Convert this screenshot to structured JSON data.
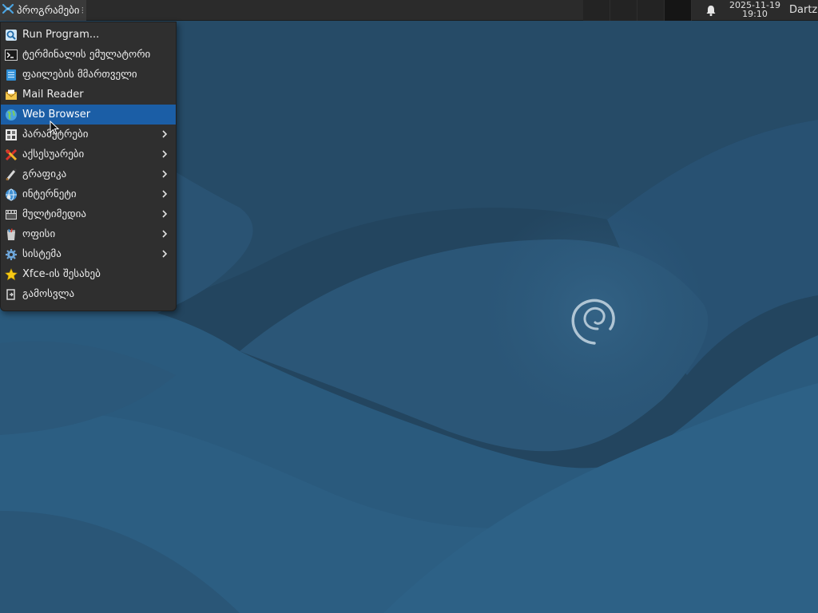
{
  "panel": {
    "apps_button_label": "პროგრამები",
    "apps_button_grip": "⁝",
    "clock_date": "2025-11-19",
    "clock_time": "19:10",
    "user_label": "Dartz",
    "workspaces": 3
  },
  "menu": {
    "items": [
      {
        "label": "Run Program...",
        "icon": "run-program-icon",
        "submenu": false
      },
      {
        "label": "ტერმინალის ემულატორი",
        "icon": "terminal-icon",
        "submenu": false
      },
      {
        "label": "ფაილების მმართველი",
        "icon": "file-manager-icon",
        "submenu": false
      },
      {
        "label": "Mail Reader",
        "icon": "mail-icon",
        "submenu": false
      },
      {
        "label": "Web Browser",
        "icon": "web-browser-icon",
        "submenu": false,
        "highlighted": true
      },
      {
        "label": "პარამეტრები",
        "icon": "settings-icon",
        "submenu": true
      },
      {
        "label": "აქსესუარები",
        "icon": "accessories-icon",
        "submenu": true
      },
      {
        "label": "გრაფიკა",
        "icon": "graphics-icon",
        "submenu": true
      },
      {
        "label": "ინტერნეტი",
        "icon": "internet-icon",
        "submenu": true
      },
      {
        "label": "მულტიმედია",
        "icon": "multimedia-icon",
        "submenu": true
      },
      {
        "label": "ოფისი",
        "icon": "office-icon",
        "submenu": true
      },
      {
        "label": "სისტემა",
        "icon": "system-icon",
        "submenu": true
      },
      {
        "label": "Xfce-ის შესახებ",
        "icon": "about-xfce-icon",
        "submenu": false
      },
      {
        "label": "გამოსვლა",
        "icon": "log-out-icon",
        "submenu": false
      }
    ]
  },
  "colors": {
    "panel_bg": "#2b2b2b",
    "menu_bg": "#2f2f2f",
    "highlight": "#1b5ea6",
    "desktop_base": "#2a5c80"
  }
}
